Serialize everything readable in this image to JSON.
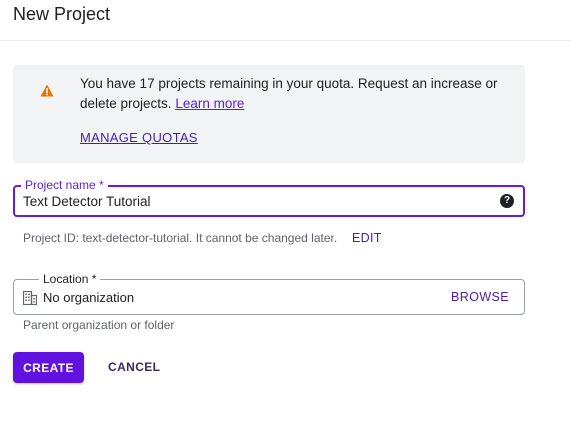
{
  "header": {
    "title": "New Project"
  },
  "quota_notice": {
    "icon": "warning-icon",
    "text": "You have 17 projects remaining in your quota. Request an increase or delete projects.",
    "learn_more": "Learn more",
    "manage_quotas": "MANAGE QUOTAS",
    "warning_color": "#e37400"
  },
  "project_name": {
    "label": "Project name *",
    "value": "Text Detector Tutorial",
    "help_icon": "help-icon",
    "accent_color": "#6a1ad9"
  },
  "project_id": {
    "text": "Project ID: text-detector-tutorial. It cannot be changed later.",
    "edit_label": "EDIT"
  },
  "location": {
    "label": "Location *",
    "icon": "organization-icon",
    "value": "No organization",
    "browse_label": "BROWSE",
    "hint": "Parent organization or folder"
  },
  "actions": {
    "create_label": "CREATE",
    "cancel_label": "CANCEL",
    "primary_color": "#6212e0"
  }
}
